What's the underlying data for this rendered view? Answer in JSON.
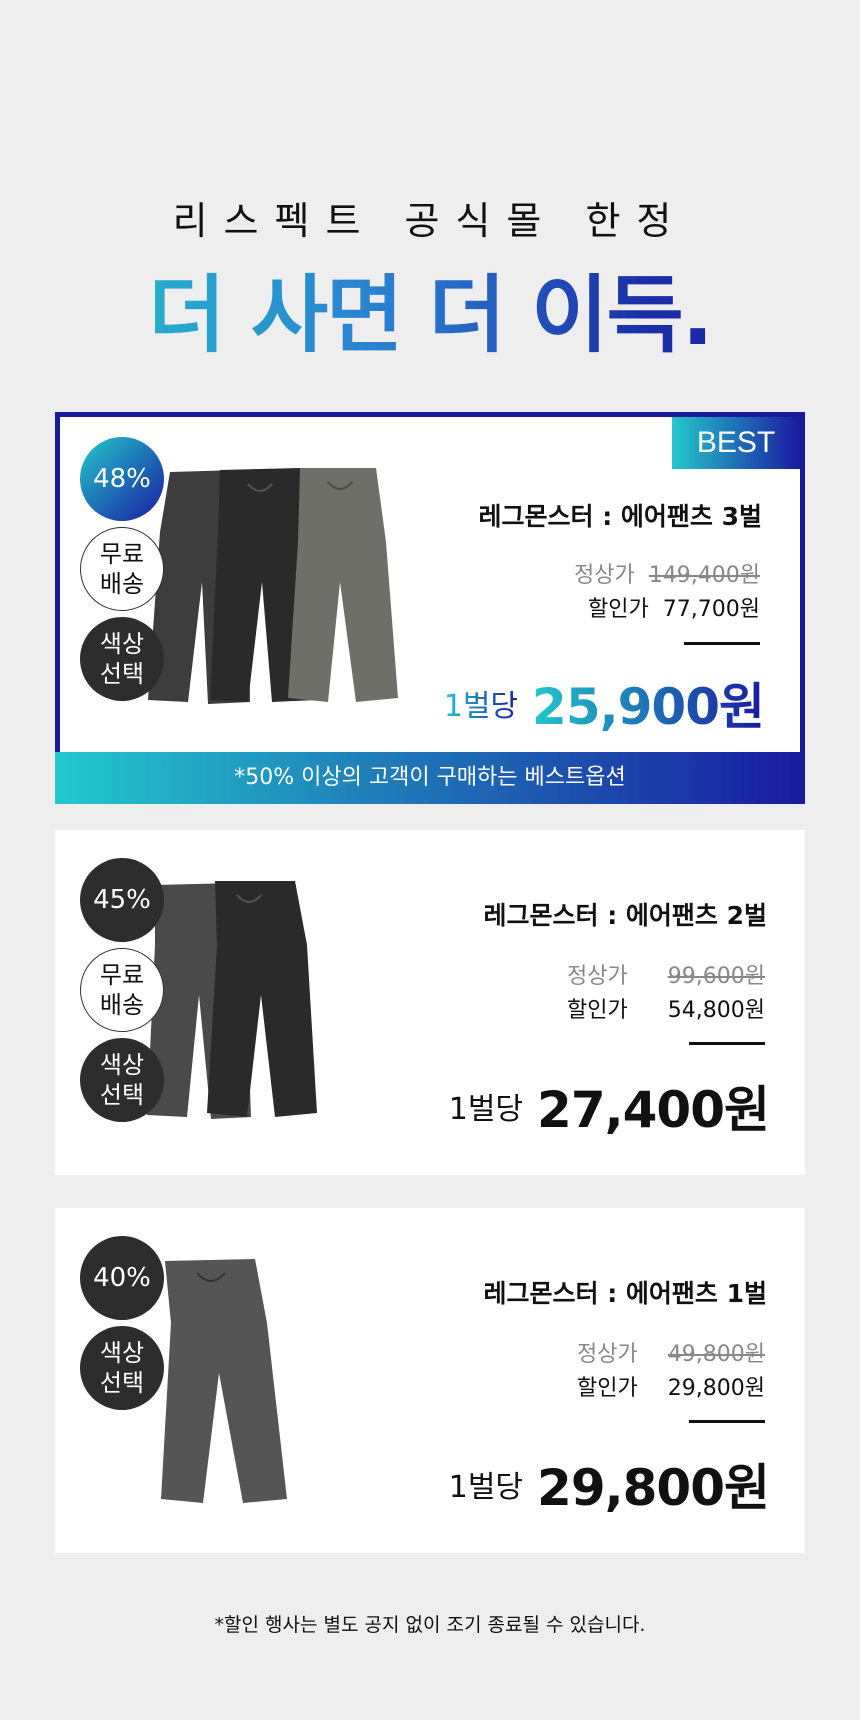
{
  "header": {
    "subtitle": "리스펙트 공식몰 한정",
    "headline": "더 사면 더 이득."
  },
  "colors": {
    "accent_start": "#23c8cc",
    "accent_end": "#1a1aa0",
    "dark_badge": "#2d2d2d",
    "background": "#eeeeef"
  },
  "products": [
    {
      "is_best": true,
      "best_label": "BEST",
      "discount": "48%",
      "badges": [
        "무료\n배송",
        "색상\n선택"
      ],
      "name": "레그몬스터 : 에어팬츠 3벌",
      "original_label": "정상가",
      "original_price": "149,400원",
      "sale_label": "할인가",
      "sale_price": "77,700원",
      "per_label": "1벌당",
      "per_price": "25,900원",
      "banner": "*50% 이상의 고객이 구매하는 베스트옵션"
    },
    {
      "is_best": false,
      "discount": "45%",
      "badges": [
        "무료\n배송",
        "색상\n선택"
      ],
      "name": "레그몬스터 : 에어팬츠 2벌",
      "original_label": "정상가",
      "original_price": "99,600원",
      "sale_label": "할인가",
      "sale_price": "54,800원",
      "per_label": "1벌당",
      "per_price": "27,400원"
    },
    {
      "is_best": false,
      "discount": "40%",
      "badges": [
        "색상\n선택"
      ],
      "name": "레그몬스터 : 에어팬츠 1벌",
      "original_label": "정상가",
      "original_price": "49,800원",
      "sale_label": "할인가",
      "sale_price": "29,800원",
      "per_label": "1벌당",
      "per_price": "29,800원"
    }
  ],
  "footnote": "*할인 행사는 별도 공지 없이 조기 종료될 수 있습니다."
}
